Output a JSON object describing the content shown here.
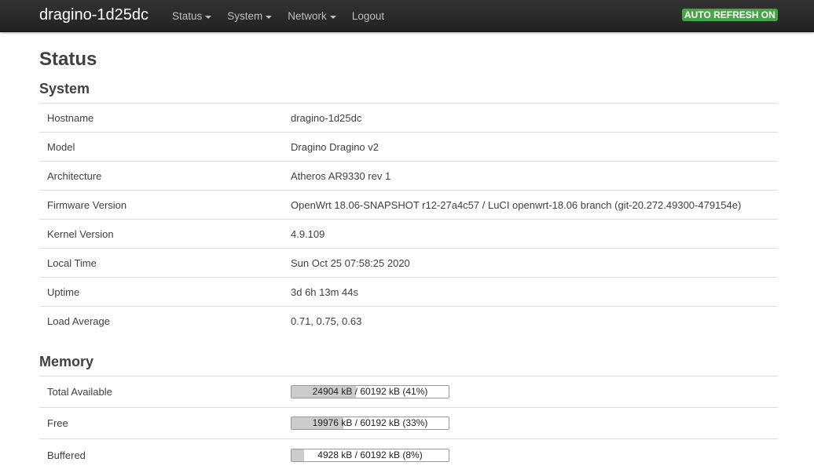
{
  "navbar": {
    "brand": "dragino-1d25dc",
    "menus": [
      {
        "label": "Status",
        "has_dropdown": true
      },
      {
        "label": "System",
        "has_dropdown": true
      },
      {
        "label": "Network",
        "has_dropdown": true
      },
      {
        "label": "Logout",
        "has_dropdown": false
      }
    ],
    "refresh_badge": "AUTO REFRESH ON"
  },
  "page": {
    "title": "Status"
  },
  "system": {
    "title": "System",
    "rows": [
      {
        "key": "Hostname",
        "value": "dragino-1d25dc"
      },
      {
        "key": "Model",
        "value": "Dragino Dragino v2"
      },
      {
        "key": "Architecture",
        "value": "Atheros AR9330 rev 1"
      },
      {
        "key": "Firmware Version",
        "value": "OpenWrt 18.06-SNAPSHOT r12-27a4c57 / LuCI openwrt-18.06 branch (git-20.272.49300-479154e)"
      },
      {
        "key": "Kernel Version",
        "value": "4.9.109"
      },
      {
        "key": "Local Time",
        "value": "Sun Oct 25 07:58:25 2020"
      },
      {
        "key": "Uptime",
        "value": "3d 6h 13m 44s"
      },
      {
        "key": "Load Average",
        "value": "0.71, 0.75, 0.63"
      }
    ]
  },
  "memory": {
    "title": "Memory",
    "rows": [
      {
        "key": "Total Available",
        "text": "24904 kB / 60192 kB (41%)",
        "percent": 41
      },
      {
        "key": "Free",
        "text": "19976 kB / 60192 kB (33%)",
        "percent": 33
      },
      {
        "key": "Buffered",
        "text": "4928 kB / 60192 kB (8%)",
        "percent": 8
      }
    ]
  },
  "colors": {
    "navbar_bg": "#222222",
    "badge_green": "#46a546",
    "progress_fill": "#cccccc"
  }
}
